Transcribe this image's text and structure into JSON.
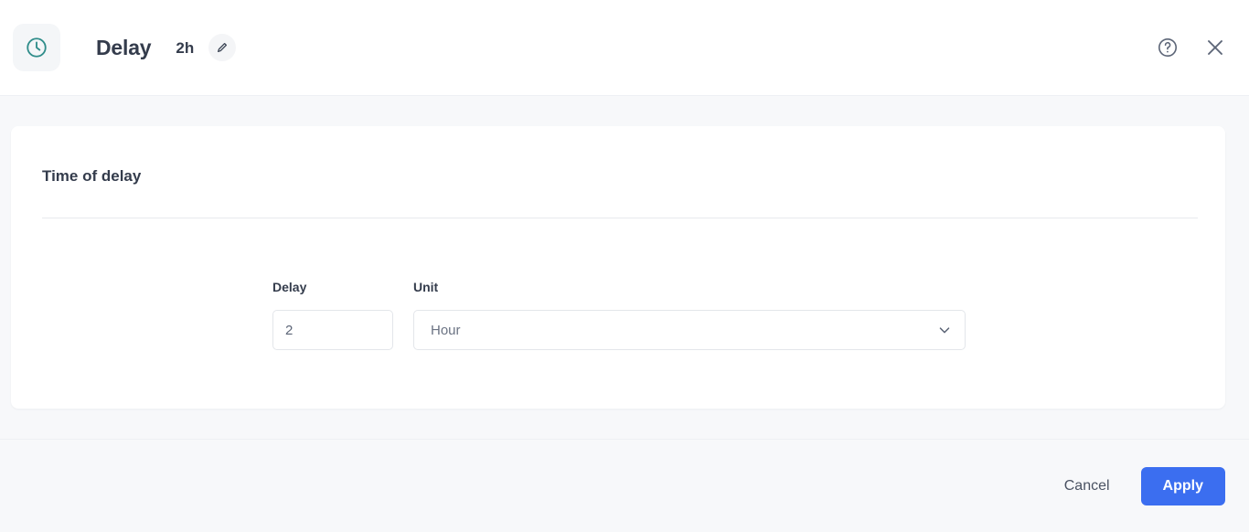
{
  "header": {
    "node_icon": "clock-icon",
    "title": "Delay",
    "subtitle": "2h",
    "edit_icon": "pencil-icon",
    "help_icon": "question-circle-icon",
    "close_icon": "close-icon",
    "icon_accent_color": "#2f8d8a"
  },
  "main": {
    "section_title": "Time of delay",
    "fields": {
      "delay": {
        "label": "Delay",
        "value": "2",
        "placeholder": "2"
      },
      "unit": {
        "label": "Unit",
        "value": "Hour",
        "chevron_icon": "chevron-down-icon"
      }
    }
  },
  "footer": {
    "cancel_label": "Cancel",
    "apply_label": "Apply",
    "apply_color": "#3b6ef0"
  }
}
